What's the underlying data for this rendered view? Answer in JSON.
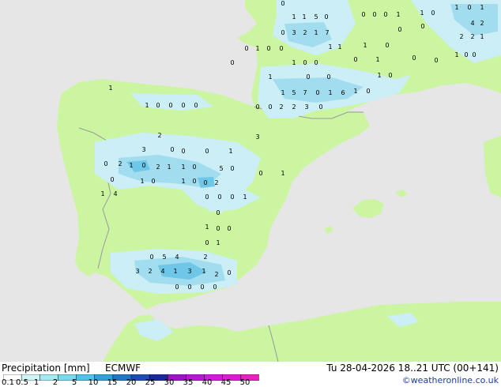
{
  "footer": {
    "title": "Precipitation [mm]",
    "model": "ECMWF",
    "valid_time": "Tu 28-04-2026 18..21 UTC (00+141)",
    "copyright": "©weatheronline.co.uk"
  },
  "legend": {
    "ticks": [
      "0.1",
      "0.5",
      "1",
      "2",
      "5",
      "10",
      "15",
      "20",
      "25",
      "30",
      "35",
      "40",
      "45",
      "50"
    ],
    "colors": [
      "#ffffff",
      "#cff4f8",
      "#a6e9f2",
      "#7bd9ee",
      "#4fc4e8",
      "#2ea3d9",
      "#2277c4",
      "#1c4db4",
      "#1a27a3",
      "#9d13cf",
      "#bb14dc",
      "#d716e3",
      "#e41ad2",
      "#ee1fc0"
    ]
  },
  "map": {
    "colors": {
      "sea": "#e6e6e6",
      "land": "#ccf5a1",
      "border": "#999999",
      "precip_light": "#cbeef7",
      "precip_medium": "#a2ddef",
      "precip_heavy": "#6ec7e6",
      "label": "#000000"
    },
    "precip_labels": [
      "0",
      "1",
      "1",
      "5",
      "0",
      "0",
      "0",
      "0",
      "1",
      "1",
      "0",
      "1",
      "0",
      "1",
      "0",
      "3",
      "2",
      "1",
      "7",
      "4",
      "2",
      "2",
      "2",
      "1",
      "0",
      "1",
      "0",
      "0",
      "1",
      "1",
      "1",
      "0",
      "0",
      "0",
      "0",
      "1",
      "0",
      "0",
      "0",
      "1",
      "0",
      "0",
      "1",
      "0",
      "0",
      "1",
      "1",
      "5",
      "7",
      "0",
      "1",
      "6",
      "1",
      "0",
      "1",
      "0",
      "0",
      "0",
      "0",
      "2",
      "2",
      "3",
      "0",
      "0",
      "1",
      "0",
      "0",
      "0",
      "0",
      "1",
      "2",
      "0",
      "0",
      "1",
      "3",
      "0",
      "3",
      "0",
      "2",
      "1",
      "0",
      "2",
      "1",
      "1",
      "0",
      "5",
      "0",
      "0",
      "1",
      "0",
      "1",
      "0",
      "0",
      "2",
      "0",
      "1",
      "1",
      "4",
      "0",
      "0",
      "0",
      "1",
      "0",
      "1",
      "0",
      "0",
      "0",
      "1",
      "0",
      "5",
      "4",
      "2",
      "3",
      "2",
      "4",
      "1",
      "3",
      "1",
      "2",
      "0",
      "0",
      "0",
      "0",
      "0"
    ]
  }
}
